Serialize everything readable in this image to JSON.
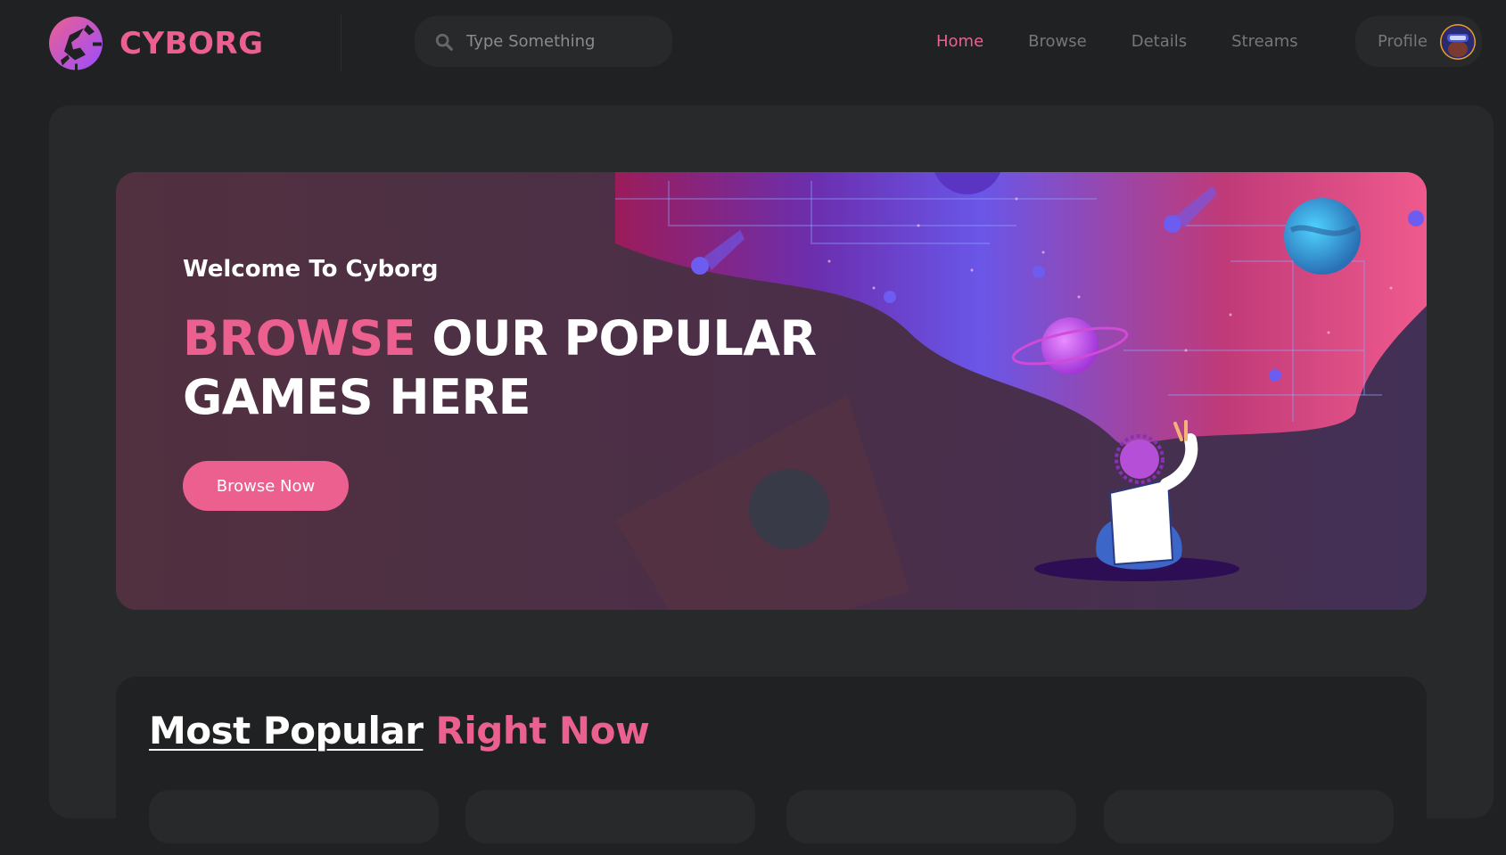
{
  "header": {
    "logo_text": "CYBORG",
    "search": {
      "placeholder": "Type Something",
      "value": ""
    },
    "nav": [
      {
        "label": "Home",
        "active": true
      },
      {
        "label": "Browse",
        "active": false
      },
      {
        "label": "Details",
        "active": false
      },
      {
        "label": "Streams",
        "active": false
      }
    ],
    "profile_label": "Profile"
  },
  "banner": {
    "welcome": "Welcome To Cyborg",
    "headline_highlight": "BROWSE",
    "headline_rest_line1": "OUR POPULAR",
    "headline_line2": "GAMES HERE",
    "button_label": "Browse Now"
  },
  "popular": {
    "title_part1": "Most Popular",
    "title_part2": "Right Now"
  },
  "colors": {
    "accent": "#ec6090",
    "background": "#1f2122",
    "panel": "#27292a"
  },
  "icons": {
    "logo": "cyborg-logo-icon",
    "search": "search-icon",
    "avatar": "avatar"
  }
}
